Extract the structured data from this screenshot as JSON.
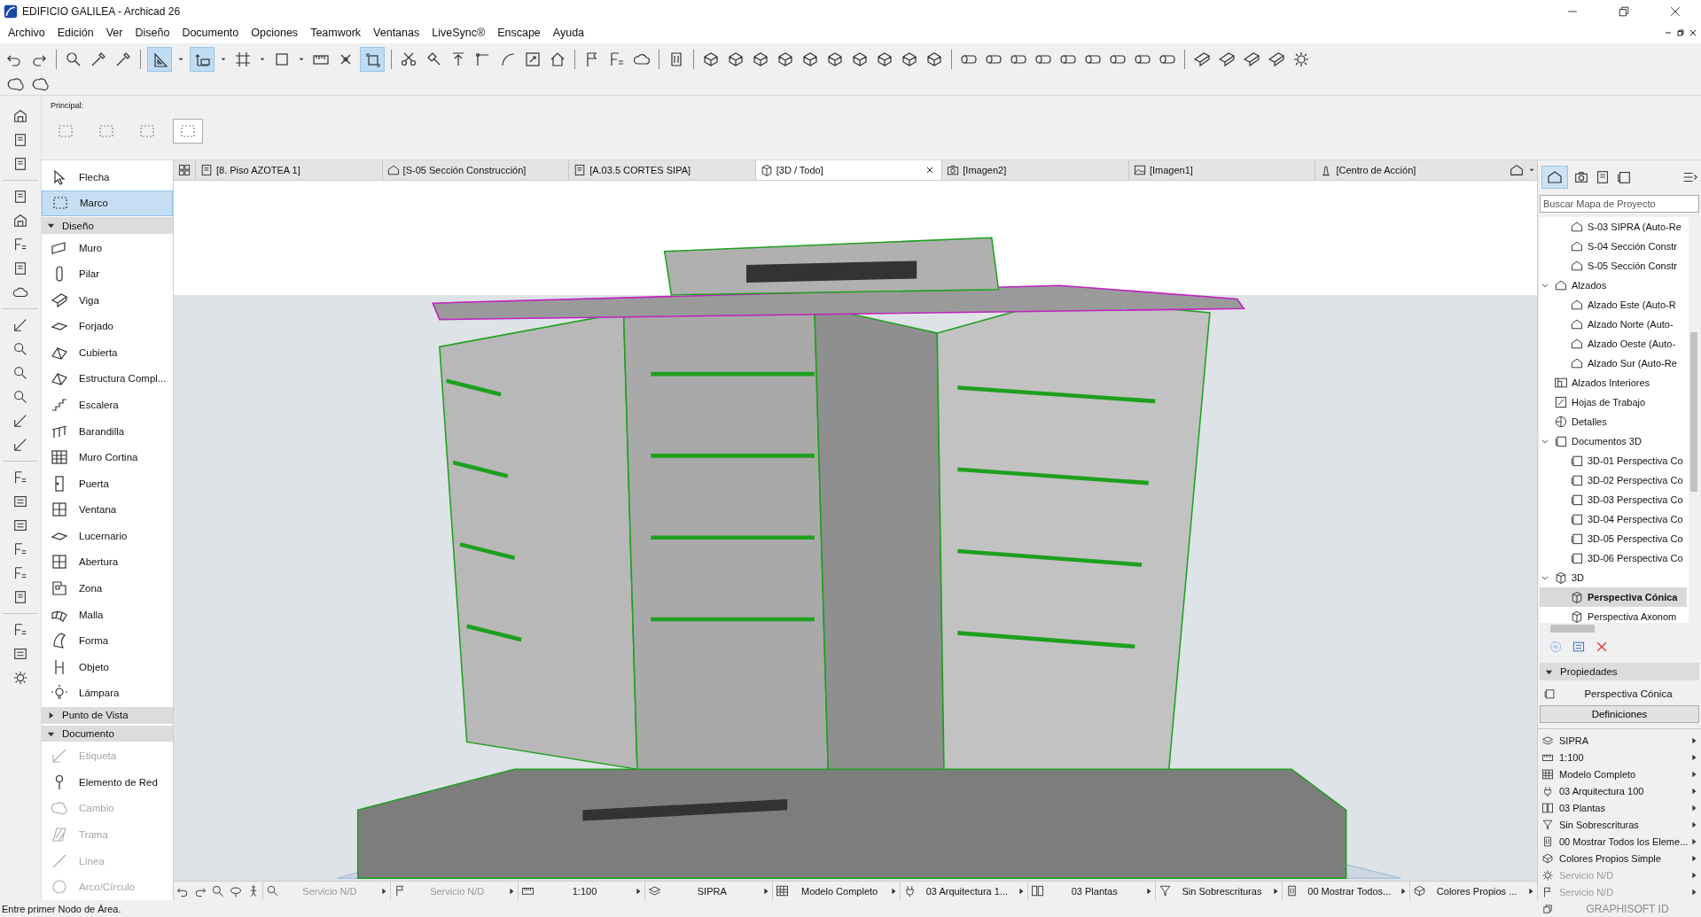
{
  "window": {
    "title": "EDIFICIO GALILEA - Archicad 26"
  },
  "menu": [
    "Archivo",
    "Edición",
    "Ver",
    "Diseño",
    "Documento",
    "Opciones",
    "Teamwork",
    "Ventanas",
    "LiveSync®",
    "Enscape",
    "Ayuda"
  ],
  "toolbar_toggles": [
    {
      "selected": true
    },
    {
      "selected": true
    },
    {
      "selected": true
    }
  ],
  "info_box": {
    "label": "Principal:",
    "selection_modes": [
      {
        "selected": false
      },
      {
        "selected": false
      },
      {
        "selected": false
      },
      {
        "selected": true
      }
    ]
  },
  "tabs": [
    {
      "label": "[8. Piso AZOTEA 1]",
      "selected": false
    },
    {
      "label": "[S-05 Sección Construcción]",
      "selected": false
    },
    {
      "label": "[A.03.5 CORTES SIPA]",
      "selected": false
    },
    {
      "label": "[3D / Todo]",
      "selected": true
    },
    {
      "label": "[Imagen2]",
      "selected": false
    },
    {
      "label": "[Imagen1]",
      "selected": false
    },
    {
      "label": "[Centro de Acción]",
      "selected": false
    }
  ],
  "toolbox": [
    {
      "kind": "tool",
      "label": "Flecha",
      "selected": false,
      "disabled": false
    },
    {
      "kind": "tool",
      "label": "Marco",
      "selected": true,
      "disabled": false
    },
    {
      "kind": "section",
      "label": "Diseño",
      "expanded": true
    },
    {
      "kind": "tool",
      "label": "Muro",
      "selected": false,
      "disabled": false
    },
    {
      "kind": "tool",
      "label": "Pilar",
      "selected": false,
      "disabled": false
    },
    {
      "kind": "tool",
      "label": "Viga",
      "selected": false,
      "disabled": false
    },
    {
      "kind": "tool",
      "label": "Forjado",
      "selected": false,
      "disabled": false
    },
    {
      "kind": "tool",
      "label": "Cubierta",
      "selected": false,
      "disabled": false
    },
    {
      "kind": "tool",
      "label": "Estructura Compl...",
      "selected": false,
      "disabled": false
    },
    {
      "kind": "tool",
      "label": "Escalera",
      "selected": false,
      "disabled": false
    },
    {
      "kind": "tool",
      "label": "Barandilla",
      "selected": false,
      "disabled": false
    },
    {
      "kind": "tool",
      "label": "Muro Cortina",
      "selected": false,
      "disabled": false
    },
    {
      "kind": "tool",
      "label": "Puerta",
      "selected": false,
      "disabled": false
    },
    {
      "kind": "tool",
      "label": "Ventana",
      "selected": false,
      "disabled": false
    },
    {
      "kind": "tool",
      "label": "Lucernario",
      "selected": false,
      "disabled": false
    },
    {
      "kind": "tool",
      "label": "Abertura",
      "selected": false,
      "disabled": false
    },
    {
      "kind": "tool",
      "label": "Zona",
      "selected": false,
      "disabled": false
    },
    {
      "kind": "tool",
      "label": "Malla",
      "selected": false,
      "disabled": false
    },
    {
      "kind": "tool",
      "label": "Forma",
      "selected": false,
      "disabled": false
    },
    {
      "kind": "tool",
      "label": "Objeto",
      "selected": false,
      "disabled": false
    },
    {
      "kind": "tool",
      "label": "Lámpara",
      "selected": false,
      "disabled": false
    },
    {
      "kind": "section",
      "label": "Punto de Vista",
      "expanded": false
    },
    {
      "kind": "section",
      "label": "Documento",
      "expanded": true
    },
    {
      "kind": "tool",
      "label": "Etiqueta",
      "selected": false,
      "disabled": true
    },
    {
      "kind": "tool",
      "label": "Elemento de Red",
      "selected": false,
      "disabled": false
    },
    {
      "kind": "tool",
      "label": "Cambio",
      "selected": false,
      "disabled": true
    },
    {
      "kind": "tool",
      "label": "Trama",
      "selected": false,
      "disabled": true
    },
    {
      "kind": "tool",
      "label": "Línea",
      "selected": false,
      "disabled": true
    },
    {
      "kind": "tool",
      "label": "Arco/Círculo",
      "selected": false,
      "disabled": true
    }
  ],
  "navigator": {
    "search_placeholder": "Buscar Mapa de Proyecto",
    "continued_items": [
      {
        "label": "S-03 SIPRA (Auto-Re",
        "selected": false
      },
      {
        "label": "S-04 Sección Constr",
        "selected": false
      },
      {
        "label": "S-05 Sección Constr",
        "selected": false
      }
    ],
    "tree": [
      {
        "label": "Alzados",
        "expanded": true,
        "selected": false,
        "children": [
          {
            "label": "Alzado Este (Auto-R",
            "selected": false
          },
          {
            "label": "Alzado Norte (Auto-",
            "selected": false
          },
          {
            "label": "Alzado Oeste (Auto-",
            "selected": false
          },
          {
            "label": "Alzado Sur (Auto-Re",
            "selected": false
          }
        ]
      },
      {
        "label": "Alzados Interiores",
        "selected": false
      },
      {
        "label": "Hojas de Trabajo",
        "selected": false
      },
      {
        "label": "Detalles",
        "selected": false
      },
      {
        "label": "Documentos 3D",
        "expanded": true,
        "selected": false,
        "children": [
          {
            "label": "3D-01 Perspectiva Co",
            "selected": false
          },
          {
            "label": "3D-02 Perspectiva Co",
            "selected": false
          },
          {
            "label": "3D-03 Perspectiva Co",
            "selected": false
          },
          {
            "label": "3D-04 Perspectiva Co",
            "selected": false
          },
          {
            "label": "3D-05 Perspectiva Co",
            "selected": false
          },
          {
            "label": "3D-06 Perspectiva Co",
            "selected": false
          }
        ]
      },
      {
        "label": "3D",
        "expanded": true,
        "selected": false,
        "children": [
          {
            "label": "Perspectiva Cónica",
            "selected": true
          },
          {
            "label": "Perspectiva Axonom",
            "selected": false
          }
        ]
      }
    ]
  },
  "properties": {
    "title": "Propiedades",
    "expanded": true,
    "view_name": "Perspectiva Cónica",
    "button": "Definiciones",
    "settings": [
      {
        "label": "SIPRA",
        "disabled": false
      },
      {
        "label": "1:100",
        "disabled": false
      },
      {
        "label": "Modelo Completo",
        "disabled": false
      },
      {
        "label": "03 Arquitectura 100",
        "disabled": false
      },
      {
        "label": "03 Plantas",
        "disabled": false
      },
      {
        "label": "Sin Sobrescrituras",
        "disabled": false
      },
      {
        "label": "00 Mostrar Todos los Eleme...",
        "disabled": false
      },
      {
        "label": "Colores Propios Simple",
        "disabled": false
      },
      {
        "label": "Servicio N/D",
        "disabled": true
      },
      {
        "label": "Servicio N/D",
        "disabled": true
      }
    ]
  },
  "status_bar": [
    {
      "label": "Servicio N/D",
      "disabled": true
    },
    {
      "label": "Servicio N/D",
      "disabled": true
    },
    {
      "label": "1:100",
      "disabled": false
    },
    {
      "label": "SIPRA",
      "disabled": false
    },
    {
      "label": "Modelo Completo",
      "disabled": false
    },
    {
      "label": "03 Arquitectura 1...",
      "disabled": false
    },
    {
      "label": "03 Plantas",
      "disabled": false
    },
    {
      "label": "Sin Sobrescrituras",
      "disabled": false
    },
    {
      "label": "00 Mostrar Todos...",
      "disabled": false
    },
    {
      "label": "Colores Propios ...",
      "disabled": false
    }
  ],
  "footer": {
    "message": "Entre primer Nodo de Área.",
    "brand": "GRAPHISOFT ID"
  }
}
